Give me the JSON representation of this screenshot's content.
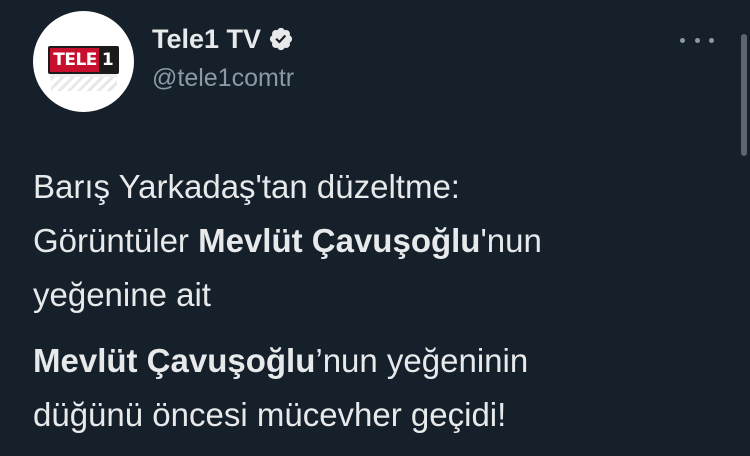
{
  "account": {
    "display_name": "Tele1 TV",
    "handle": "@tele1comtr",
    "logo_text_red": "TELE",
    "logo_text_dark": "1",
    "verified": true
  },
  "tweet": {
    "line1": "Barış Yarkadaş'tan düzeltme:",
    "line2_prefix": "Görüntüler ",
    "line2_bold": "Mevlüt Çavuşoğlu",
    "line2_suffix": "'nun",
    "line3": "yeğenine ait",
    "para2_bold": "Mevlüt Çavuşoğlu",
    "para2_rest1": "’nun yeğeninin",
    "para2_rest2": "düğünü öncesi mücevher geçidi!"
  },
  "colors": {
    "background": "#15202b",
    "text": "#e7e9ea",
    "secondary": "#8b98a5",
    "logo_red": "#c8102e"
  },
  "icons": {
    "verified": "verified-badge-icon",
    "more": "more-icon"
  }
}
